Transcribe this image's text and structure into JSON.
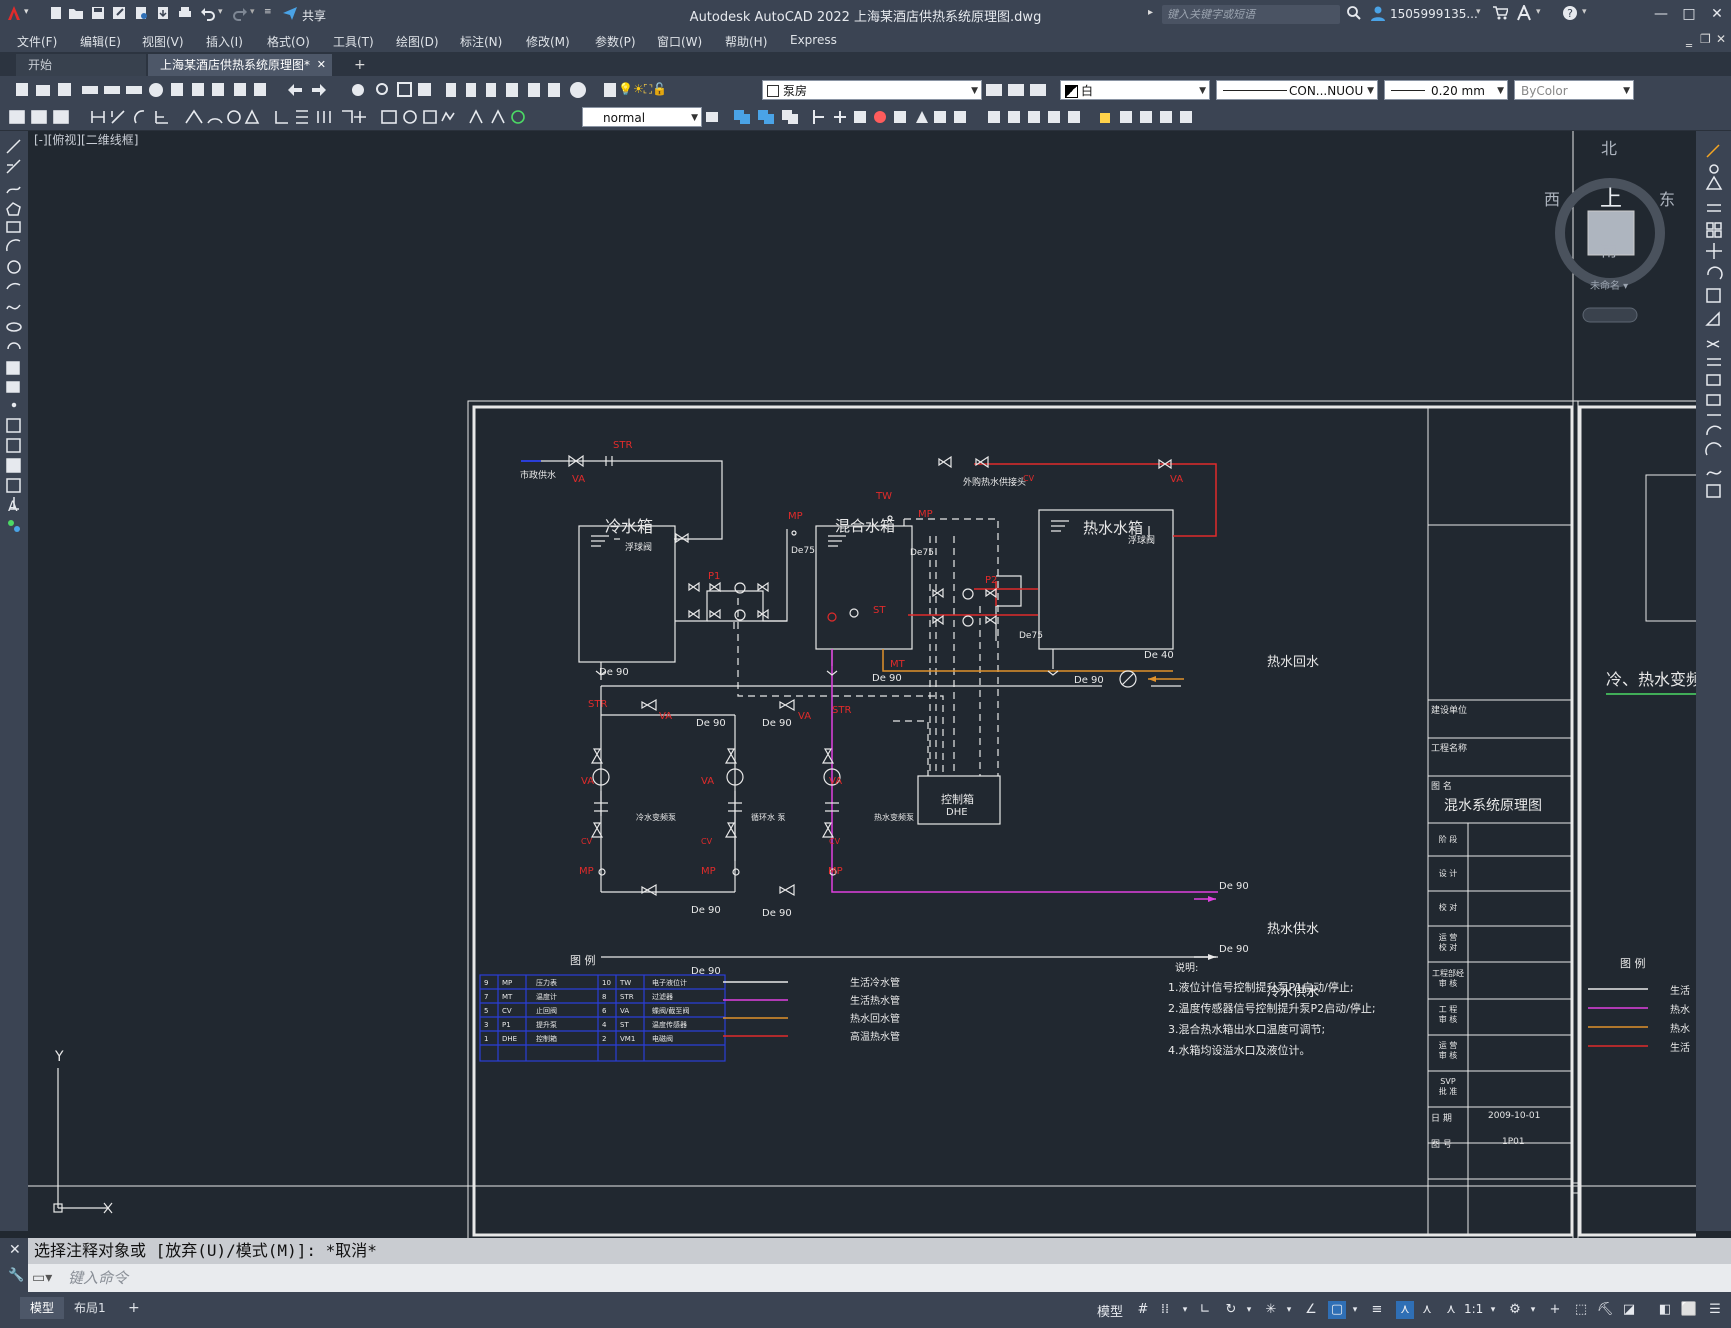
{
  "app": {
    "window_title": "Autodesk AutoCAD 2022    上海某酒店供热系统原理图.dwg",
    "share_label": "共享",
    "search_placeholder": "键入关键字或短语",
    "user_name": "1505999135...",
    "window_buttons": [
      "—",
      "□",
      "✕"
    ]
  },
  "menu": [
    "文件(F)",
    "编辑(E)",
    "视图(V)",
    "插入(I)",
    "格式(O)",
    "工具(T)",
    "绘图(D)",
    "标注(N)",
    "修改(M)",
    "参数(P)",
    "窗口(W)",
    "帮助(H)",
    "Express"
  ],
  "tabs": {
    "start": "开始",
    "active": "上海某酒店供热系统原理图*",
    "close": "✕",
    "add": "+"
  },
  "toolbar": {
    "layer_value": "泵房",
    "color_value": "白",
    "linetype_value": "CON...NUOU",
    "lineweight_value": "0.20 mm",
    "plotstyle_value": "ByColor",
    "dimstyle_value": "normal"
  },
  "viewport": {
    "label": "[-][俯视][二维线框]",
    "viewcube": {
      "north": "北",
      "south": "南",
      "east": "东",
      "west": "西",
      "top": "上",
      "wcs": "未命名 ▾"
    },
    "ucs": {
      "x": "X",
      "y": "Y"
    }
  },
  "drawing": {
    "labels": {
      "city_water": "市政供水",
      "cold_tank": "冷水箱",
      "mix_tank": "混合水箱",
      "hot_tank": "热水水箱",
      "float_valve": "浮球阀",
      "external_heat": "外购热水供接头",
      "control_box": "控制箱",
      "dhe": "DHE",
      "hot_return": "热水回水",
      "hot_supply": "热水供水",
      "cold_supply": "冷水供水",
      "pump1": "冷水变频泵",
      "pump2": "循环水 泵",
      "pump3": "热水变频泵",
      "legend_title": "图      例",
      "notes_title": "说明:"
    },
    "tags": {
      "str": "STR",
      "va": "VA",
      "cv": "CV",
      "mp": "MP",
      "mt": "MT",
      "tw": "TW",
      "st": "ST",
      "p1": "P1",
      "p2": "P2",
      "de90": "De 90",
      "de75": "De75",
      "de40": "De 40"
    },
    "legend_rows": [
      [
        "9",
        "MP",
        "压力表",
        "10",
        "TW",
        "电子液位计"
      ],
      [
        "7",
        "MT",
        "温度计",
        "8",
        "STR",
        "过滤器"
      ],
      [
        "5",
        "CV",
        "止回阀",
        "6",
        "VA",
        "蝶阀/截至阀"
      ],
      [
        "3",
        "P1",
        "提升泵",
        "4",
        "ST",
        "温度传感器"
      ],
      [
        "1",
        "DHE",
        "控制箱",
        "2",
        "VM1",
        "电磁阀"
      ]
    ],
    "line_legend": [
      "生活冷水管",
      "生活热水管",
      "热水回水管",
      "高温热水管"
    ],
    "notes": [
      "1.液位计信号控制提升泵P1启动/停止;",
      "2.温度传感器信号控制提升泵P2启动/停止;",
      "3.混合热水箱出水口温度可调节;",
      "4.水箱均设溢水口及液位计。"
    ],
    "title_block": {
      "build_unit": "建设单位",
      "project_name": "工程名称",
      "drawing_name_label": "图  名",
      "drawing_name": "混水系统原理图",
      "rows": [
        "阶  段",
        "设  计",
        "校  对",
        "运 营\n校 对",
        "工程部经\n审  核",
        "工  程\n审  核",
        "运  营\n审  核",
        "SVP\n批  准"
      ],
      "date_label": "日  期",
      "date_value": "2009-10-01",
      "num_label": "图  号",
      "num_value": "1P01"
    },
    "right_sheet_title": "冷、热水变频",
    "right_legend_title": "图      例",
    "right_line_legend": [
      "生活",
      "热水",
      "热水",
      "生活"
    ]
  },
  "command": {
    "history": "选择注释对象或 [放弃(U)/模式(M)]: *取消*",
    "placeholder": "键入命令"
  },
  "status": {
    "model_tab": "模型",
    "layout_tab": "布局1",
    "add": "+",
    "model_btn": "模型",
    "scale": "1:1"
  },
  "colors": {
    "bg": "#212830",
    "panel": "#3b4453",
    "white_line": "#e8e8e8",
    "red": "#e02b2b",
    "magenta": "#e040e0",
    "orange": "#e0912b",
    "blue": "#2a3ed8"
  }
}
